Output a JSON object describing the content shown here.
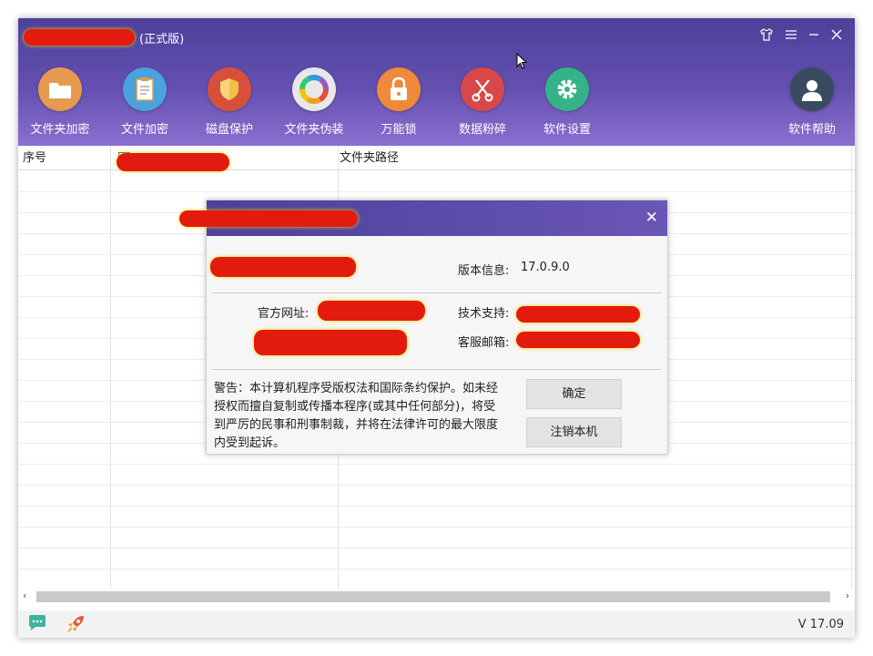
{
  "window": {
    "title_suffix": "(正式版)"
  },
  "toolbar": {
    "items": [
      {
        "label": "文件夹加密",
        "icon": "folder-icon",
        "color": "#e69a50"
      },
      {
        "label": "文件加密",
        "icon": "document-icon",
        "color": "#4aa3dc"
      },
      {
        "label": "磁盘保护",
        "icon": "shield-icon",
        "color": "#d8503a"
      },
      {
        "label": "文件夹伪装",
        "icon": "color-wheel-icon",
        "color": "#e8e8e8"
      },
      {
        "label": "万能锁",
        "icon": "lock-icon",
        "color": "#ee8a3a"
      },
      {
        "label": "数据粉碎",
        "icon": "scissors-icon",
        "color": "#d84848"
      },
      {
        "label": "软件设置",
        "icon": "gear-icon",
        "color": "#34b389"
      }
    ],
    "help": {
      "label": "软件帮助",
      "icon": "user-icon",
      "color": "#3a4a60"
    }
  },
  "table": {
    "columns": [
      "序号",
      "",
      "文件夹路径"
    ]
  },
  "status": {
    "version": "V 17.09"
  },
  "dialog": {
    "version_label": "版本信息:",
    "version_value": "17.0.9.0",
    "website_label": "官方网址:",
    "support_label": "技术支持:",
    "email_label": "客服邮箱:",
    "warning": "警告：本计算机程序受版权法和国际条约保护。如未经授权而擅自复制或传播本程序(或其中任何部分)，将受到严厉的民事和刑事制裁，并将在法律许可的最大限度内受到起诉。",
    "ok_button": "确定",
    "unregister_button": "注销本机"
  },
  "colors": {
    "header_dark": "#4d3f9a",
    "header_light": "#8a6fd0",
    "redaction": "#e31b0e"
  }
}
